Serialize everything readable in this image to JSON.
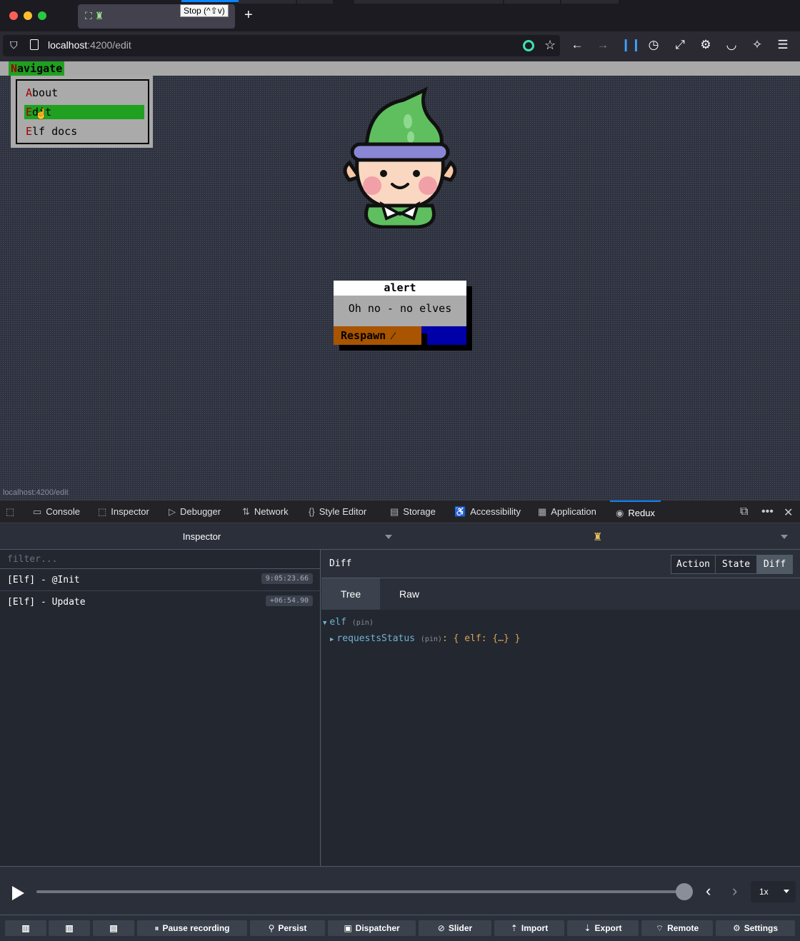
{
  "browser": {
    "tooltip": "Stop (^⇧v)",
    "url_host": "localhost",
    "url_rest": ":4200/edit",
    "status_url": "localhost:4200/edit"
  },
  "app": {
    "nav_hot": "N",
    "nav_rest": "avigate",
    "menu_items": [
      {
        "hot": "A",
        "rest": "bout"
      },
      {
        "hot": "E",
        "rest": "dit"
      },
      {
        "hot": "E",
        "rest": "lf docs"
      }
    ],
    "alert_title": "alert",
    "alert_message": "Oh no - no elves",
    "respawn_label": "Respawn"
  },
  "devtools": {
    "tabs": [
      "Console",
      "Inspector",
      "Debugger",
      "Network",
      "Style Editor",
      "Storage",
      "Accessibility",
      "Application",
      "Redux"
    ],
    "active_tab": "Redux"
  },
  "redux": {
    "monitor_label": "Inspector",
    "filter_placeholder": "filter...",
    "actions": [
      {
        "name": "[Elf] - @Init",
        "time": "9:05:23.66"
      },
      {
        "name": "[Elf] - Update",
        "time": "+06:54.90"
      }
    ],
    "diff_title": "Diff",
    "segments": [
      "Action",
      "State",
      "Diff"
    ],
    "active_segment": "Diff",
    "subtabs": [
      "Tree",
      "Raw"
    ],
    "active_subtab": "Tree",
    "tree": {
      "root_key": "elf",
      "pin": "(pin)",
      "child_key": "requestsStatus",
      "child_value": ": { elf: {…} }"
    },
    "speed": "1x",
    "slider_value": 1.0,
    "buttons": [
      "Pause recording",
      "Persist",
      "Dispatcher",
      "Slider",
      "Import",
      "Export",
      "Remote",
      "Settings"
    ]
  }
}
